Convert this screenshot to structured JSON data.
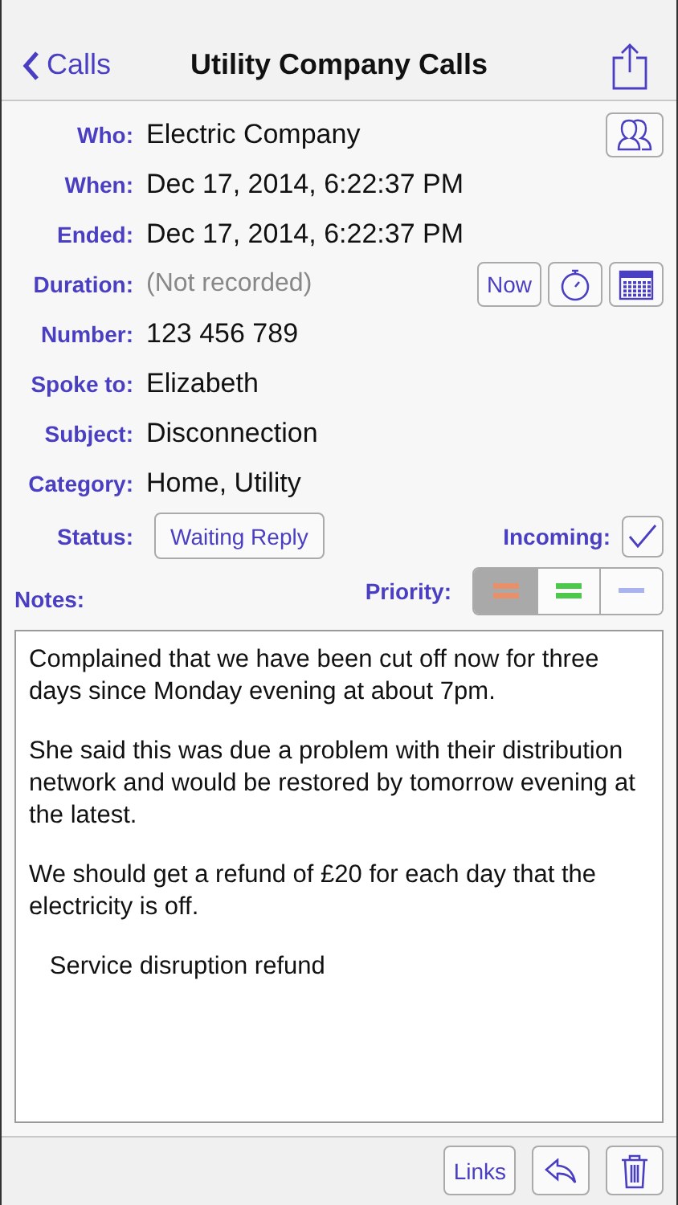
{
  "nav": {
    "back": "Calls",
    "title": "Utility Company Calls"
  },
  "fields": [
    {
      "label": "Who:",
      "value": "Electric Company",
      "actions": [
        {
          "kind": "contacts"
        }
      ]
    },
    {
      "label": "When:",
      "value": "Dec 17, 2014, 6:22:37 PM"
    },
    {
      "label": "Ended:",
      "value": "Dec 17, 2014, 6:22:37 PM"
    },
    {
      "label": "Duration:",
      "placeholder": "(Not recorded)",
      "actions": [
        {
          "kind": "text",
          "label": "Now"
        },
        {
          "kind": "stopwatch"
        },
        {
          "kind": "calendar"
        }
      ]
    },
    {
      "label": "Number:",
      "value": "123 456 789"
    },
    {
      "label": "Spoke to:",
      "value": "Elizabeth"
    },
    {
      "label": "Subject:",
      "value": "Disconnection"
    },
    {
      "label": "Category:",
      "value": "Home, Utility"
    }
  ],
  "status": {
    "label": "Status:",
    "value": "Waiting Reply"
  },
  "incoming": {
    "label": "Incoming:",
    "checked": true
  },
  "notes_label": "Notes:",
  "priority": {
    "label": "Priority:",
    "options": [
      {
        "color": "#e8906a",
        "kind": "equal",
        "selected": true
      },
      {
        "color": "#4cc94c",
        "kind": "equal",
        "selected": false
      },
      {
        "color": "#a9b4ee",
        "kind": "dash",
        "selected": false
      }
    ]
  },
  "notes": [
    "Complained that we have been cut off now for three days since Monday evening at about 7pm.",
    "She said this was due a problem with their distribution network and would be restored by tomorrow evening at the latest.",
    "We should get a refund of £20 for each day that the electricity is off.",
    "   Service disruption refund"
  ],
  "toolbar": {
    "links": "Links"
  }
}
